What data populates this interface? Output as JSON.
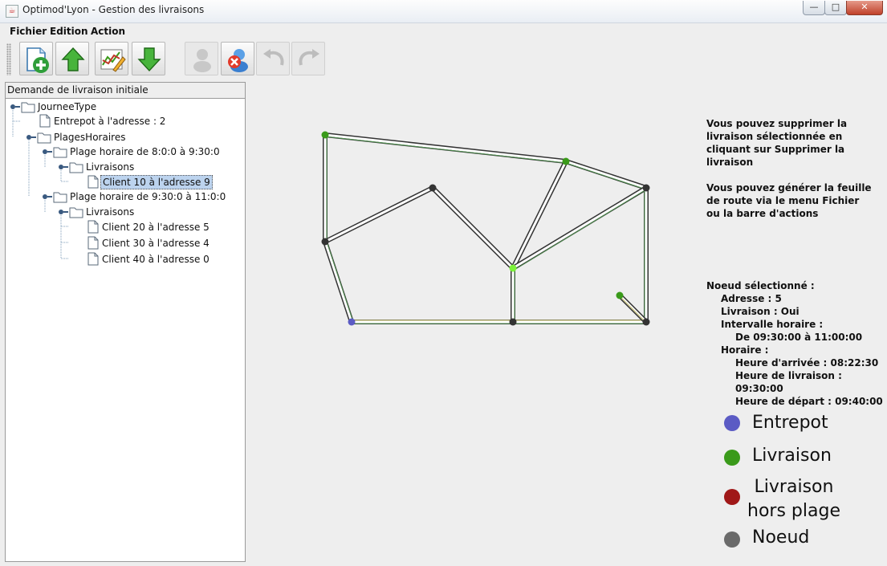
{
  "window": {
    "title": "Optimod'Lyon - Gestion des livraisons"
  },
  "menubar": {
    "items": [
      "Fichier",
      "Edition",
      "Action"
    ]
  },
  "toolbar": {
    "buttons": [
      {
        "name": "new-icon",
        "enabled": true
      },
      {
        "name": "upload-icon",
        "enabled": true
      },
      {
        "name": "route-edit-icon",
        "enabled": true
      },
      {
        "name": "download-icon",
        "enabled": true
      },
      {
        "name": "add-delivery-icon",
        "enabled": false
      },
      {
        "name": "delete-delivery-icon",
        "enabled": true
      },
      {
        "name": "undo-icon",
        "enabled": false
      },
      {
        "name": "redo-icon",
        "enabled": false
      }
    ]
  },
  "tree": {
    "header": "Demande de livraison initiale",
    "root": "JourneeType",
    "entrepot": "Entrepot à l'adresse : 2",
    "plages_root": "PlagesHoraires",
    "plage1": "Plage horaire de 8:0:0 à 9:30:0",
    "plage1_livraisons": "Livraisons",
    "plage1_clients": [
      "Client 10 à l'adresse 9"
    ],
    "plage2": "Plage horaire de 9:30:0 à 11:0:0",
    "plage2_livraisons": "Livraisons",
    "plage2_clients": [
      "Client 20 à l'adresse 5",
      "Client 30 à l'adresse 4",
      "Client 40 à l'adresse 0"
    ],
    "selected": "Client 10 à l'adresse 9"
  },
  "info": {
    "message1": "Vous pouvez supprimer la livraison sélectionnée en cliquant sur Supprimer la livraison",
    "message2": "Vous pouvez générer la feuille de route via le menu Fichier ou la barre d'actions",
    "selected_title": "Noeud sélectionné :",
    "adresse": "Adresse : 5",
    "livraison": "Livraison : Oui",
    "intervalle_label": "Intervalle horaire :",
    "intervalle": "De 09:30:00 à 11:00:00",
    "horaire_label": "Horaire :",
    "arrivee": "Heure d'arrivée : 08:22:30",
    "heure_livraison": "Heure de livraison : 09:30:00",
    "depart": "Heure de départ : 09:40:00"
  },
  "legend": [
    {
      "label": "Entrepot",
      "color": "#5b5bc4"
    },
    {
      "label": "Livraison",
      "color": "#3a9a1a"
    },
    {
      "label": "Livraison\nhors plage",
      "color": "#a01818"
    },
    {
      "label": "Noeud",
      "color": "#6a6a6a"
    }
  ],
  "colors": {
    "entrepot": "#5b5bc4",
    "livraison": "#3a9a1a",
    "livraison_selected": "#7cf23a",
    "noeud": "#333333",
    "route_green": "#4f8f4f",
    "route_yellow": "#c8c27a"
  }
}
